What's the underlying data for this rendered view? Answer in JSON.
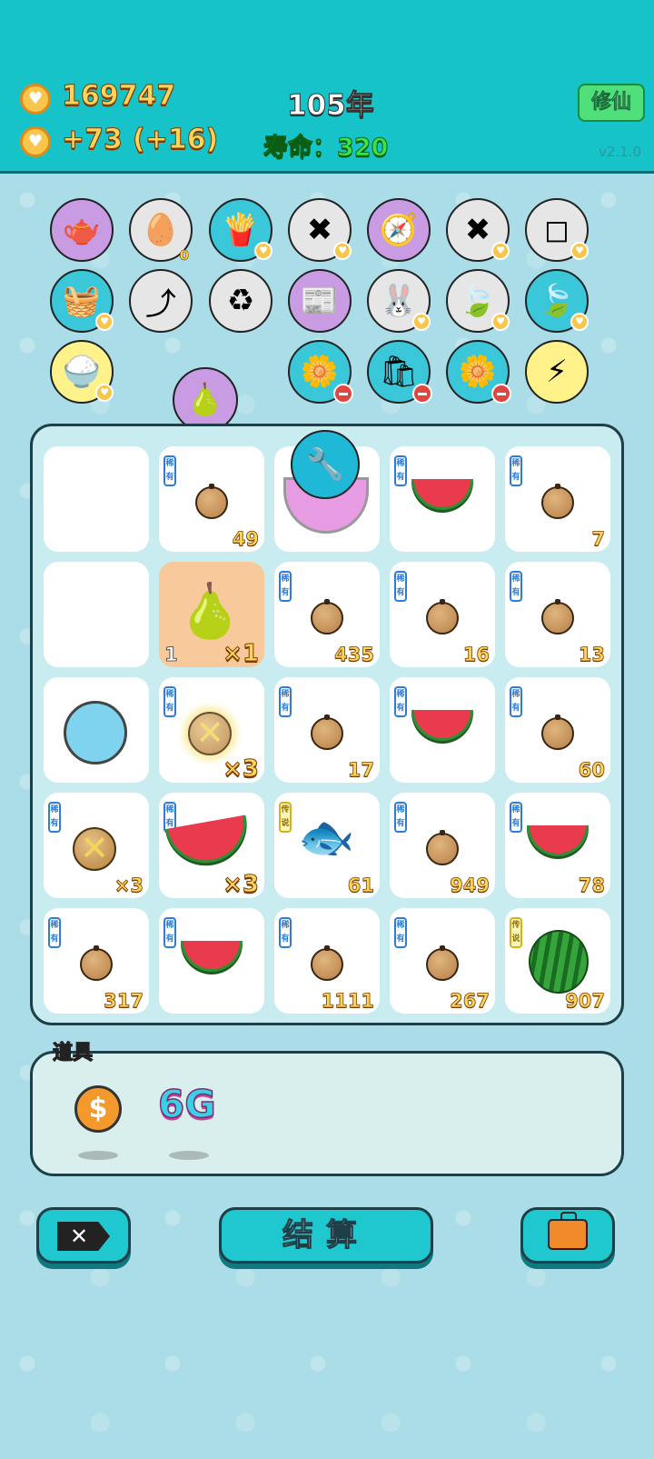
{
  "header": {
    "coins": "169747",
    "income": "+73",
    "bonus": "(+16)",
    "year": "105年",
    "life_label": "寿命：",
    "life_value": "320",
    "cultivate_label": "修仙",
    "version": "v2.1.0"
  },
  "item_row3_count": "0",
  "board": {
    "rare_tag": "稀有",
    "legend_tag": "传说",
    "cells": [
      {
        "r": 0,
        "c": 0,
        "kind": "empty"
      },
      {
        "r": 0,
        "c": 1,
        "kind": "nut",
        "tag": "rare",
        "num": "49"
      },
      {
        "r": 0,
        "c": 2,
        "kind": "bowl"
      },
      {
        "r": 0,
        "c": 3,
        "kind": "melon",
        "tag": "rare"
      },
      {
        "r": 0,
        "c": 4,
        "kind": "nut",
        "tag": "rare",
        "num": "7"
      },
      {
        "r": 1,
        "c": 0,
        "kind": "empty"
      },
      {
        "r": 1,
        "c": 1,
        "kind": "pears",
        "left": "1",
        "mult": "×1"
      },
      {
        "r": 1,
        "c": 2,
        "kind": "nut",
        "tag": "rare",
        "num": "435"
      },
      {
        "r": 1,
        "c": 3,
        "kind": "nut",
        "tag": "rare",
        "num": "16"
      },
      {
        "r": 1,
        "c": 4,
        "kind": "nut",
        "tag": "rare",
        "num": "13"
      },
      {
        "r": 2,
        "c": 0,
        "kind": "dice"
      },
      {
        "r": 2,
        "c": 1,
        "kind": "xnut-glow",
        "tag": "rare",
        "mult": "×3"
      },
      {
        "r": 2,
        "c": 2,
        "kind": "nut",
        "tag": "rare",
        "num": "17"
      },
      {
        "r": 2,
        "c": 3,
        "kind": "melon",
        "tag": "rare"
      },
      {
        "r": 2,
        "c": 4,
        "kind": "nut",
        "tag": "rare",
        "num": "60"
      },
      {
        "r": 3,
        "c": 0,
        "kind": "xnut",
        "tag": "rare",
        "num": "×3"
      },
      {
        "r": 3,
        "c": 1,
        "kind": "melon-big",
        "tag": "rare",
        "mult": "×3"
      },
      {
        "r": 3,
        "c": 2,
        "kind": "fish",
        "tag": "legend",
        "num": "61"
      },
      {
        "r": 3,
        "c": 3,
        "kind": "nut",
        "tag": "rare",
        "num": "949"
      },
      {
        "r": 3,
        "c": 4,
        "kind": "melon",
        "tag": "rare",
        "num": "78"
      },
      {
        "r": 4,
        "c": 0,
        "kind": "nut",
        "tag": "rare",
        "num": "317"
      },
      {
        "r": 4,
        "c": 1,
        "kind": "melon",
        "tag": "rare"
      },
      {
        "r": 4,
        "c": 2,
        "kind": "nut",
        "tag": "rare",
        "num": "1111"
      },
      {
        "r": 4,
        "c": 3,
        "kind": "nut",
        "tag": "rare",
        "num": "267"
      },
      {
        "r": 4,
        "c": 4,
        "kind": "wmelon",
        "tag": "legend",
        "num": "907"
      }
    ]
  },
  "tools": {
    "title": "道具",
    "coin_symbol": "$",
    "amount": "6G"
  },
  "buttons": {
    "settle": "结算"
  }
}
